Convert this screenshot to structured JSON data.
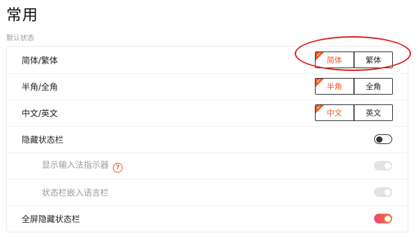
{
  "page": {
    "title": "常用",
    "section_label": "默认状态"
  },
  "rows": {
    "script": {
      "label": "简体/繁体",
      "options": [
        "简体",
        "繁体"
      ],
      "selected": "简体"
    },
    "width": {
      "label": "半角/全角",
      "options": [
        "半角",
        "全角"
      ],
      "selected": "半角"
    },
    "lang": {
      "label": "中文/英文",
      "options": [
        "中文",
        "英文"
      ],
      "selected": "中文"
    },
    "hide_status_bar": {
      "label": "隐藏状态栏",
      "state": "off"
    },
    "show_indicator": {
      "label": "显示输入法指示器",
      "help_icon": "?",
      "state": "on-disabled"
    },
    "embed_langbar": {
      "label": "状态栏嵌入语言栏",
      "state": "on-disabled"
    },
    "fullscreen_hide": {
      "label": "全屏隐藏状态栏",
      "state": "on"
    }
  },
  "colors": {
    "accent": "#f05a28",
    "annotation": "#e02020",
    "toggle_on_start": "#f0437a",
    "toggle_on_end": "#f57a2e"
  }
}
